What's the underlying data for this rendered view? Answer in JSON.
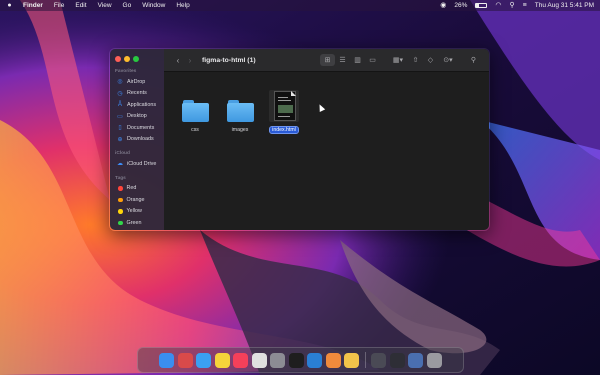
{
  "menubar": {
    "apple_icon": "apple-icon",
    "items": [
      "Finder",
      "File",
      "Edit",
      "View",
      "Go",
      "Window",
      "Help"
    ],
    "battery_percent": "26%",
    "battery_fill": 0.26,
    "datetime": "Thu Aug 31  5:41 PM"
  },
  "finder": {
    "title": "figma-to-html (1)",
    "sidebar": {
      "favorites_title": "Favorites",
      "favorites": [
        {
          "label": "AirDrop",
          "icon": "airdrop-icon"
        },
        {
          "label": "Recents",
          "icon": "clock-icon"
        },
        {
          "label": "Applications",
          "icon": "applications-icon"
        },
        {
          "label": "Desktop",
          "icon": "desktop-icon"
        },
        {
          "label": "Documents",
          "icon": "document-icon"
        },
        {
          "label": "Downloads",
          "icon": "download-icon"
        }
      ],
      "icloud_title": "iCloud",
      "icloud": [
        {
          "label": "iCloud Drive",
          "icon": "cloud-icon"
        }
      ],
      "tags_title": "Tags",
      "tags": [
        {
          "label": "Red",
          "color": "#ff453a"
        },
        {
          "label": "Orange",
          "color": "#ff9f0a"
        },
        {
          "label": "Yellow",
          "color": "#ffd60a"
        },
        {
          "label": "Green",
          "color": "#32d74b"
        }
      ]
    },
    "files": [
      {
        "name": "css",
        "type": "folder"
      },
      {
        "name": "images",
        "type": "folder"
      },
      {
        "name": "index.html",
        "type": "document",
        "selected": true
      }
    ],
    "toolbar_icons": [
      "icon-view-icon",
      "list-view-icon",
      "column-view-icon",
      "gallery-view-icon",
      "group-icon",
      "share-icon",
      "tag-icon",
      "more-icon",
      "search-icon"
    ]
  },
  "dock": {
    "apps": [
      {
        "name": "finder-icon",
        "color": "#3a8ef0"
      },
      {
        "name": "launchpad-icon",
        "color": "#d94a4a"
      },
      {
        "name": "safari-icon",
        "color": "#3aa0f2"
      },
      {
        "name": "notes-icon",
        "color": "#f5d33a"
      },
      {
        "name": "music-icon",
        "color": "#f5405a"
      },
      {
        "name": "chrome-icon",
        "color": "#e0e0e0"
      },
      {
        "name": "system-preferences-icon",
        "color": "#8c8c94"
      },
      {
        "name": "figma-icon",
        "color": "#1e1e1e"
      },
      {
        "name": "vscode-icon",
        "color": "#2a7fd4"
      },
      {
        "name": "pages-icon",
        "color": "#f08a3c"
      },
      {
        "name": "pencil-app-icon",
        "color": "#f2c34a"
      }
    ],
    "recent": [
      {
        "name": "window-thumb-1-icon",
        "color": "#4a4a55"
      },
      {
        "name": "window-thumb-2-icon",
        "color": "#2e2e36"
      },
      {
        "name": "downloads-stack-icon",
        "color": "#4a6fb0"
      },
      {
        "name": "trash-icon",
        "color": "#9a9aa0"
      }
    ]
  }
}
